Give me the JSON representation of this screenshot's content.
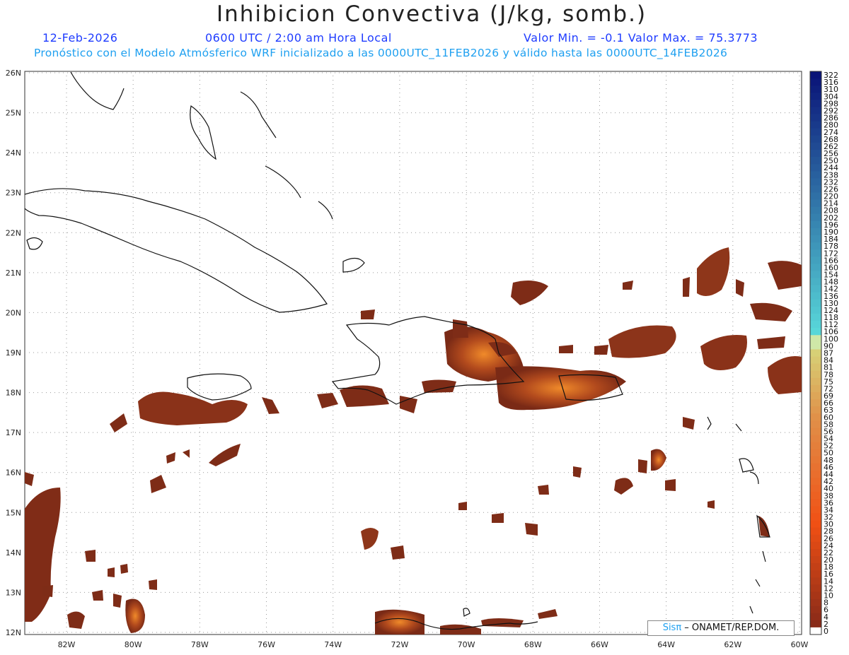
{
  "header": {
    "title": "Inhibicion Convectiva (J/kg, somb.)",
    "date": "12-Feb-2026",
    "time": "0600 UTC / 2:00 am Hora Local",
    "stats": "Valor Min. = -0.1  Valor Max. = 75.3773",
    "subtitle": "Pronóstico con el Modelo Atmósferico WRF inicializado a las 0000UTC_11FEB2026 y válido hasta las  0000UTC_14FEB2026"
  },
  "axes": {
    "lat_labels": [
      "26N",
      "25N",
      "24N",
      "23N",
      "22N",
      "21N",
      "20N",
      "19N",
      "18N",
      "17N",
      "16N",
      "15N",
      "14N",
      "13N",
      "12N"
    ],
    "lon_labels": [
      "82W",
      "80W",
      "78W",
      "76W",
      "74W",
      "72W",
      "70W",
      "68W",
      "66W",
      "64W",
      "62W",
      "60W"
    ]
  },
  "colorbar": {
    "labels": [
      "322",
      "316",
      "310",
      "304",
      "298",
      "292",
      "286",
      "280",
      "274",
      "268",
      "262",
      "256",
      "250",
      "244",
      "238",
      "232",
      "226",
      "220",
      "214",
      "208",
      "202",
      "196",
      "190",
      "184",
      "178",
      "172",
      "166",
      "160",
      "154",
      "148",
      "142",
      "136",
      "130",
      "124",
      "118",
      "112",
      "106",
      "100",
      "90",
      "87",
      "84",
      "81",
      "78",
      "75",
      "72",
      "69",
      "66",
      "63",
      "60",
      "58",
      "56",
      "54",
      "52",
      "50",
      "48",
      "46",
      "44",
      "42",
      "40",
      "38",
      "36",
      "34",
      "32",
      "30",
      "28",
      "26",
      "24",
      "22",
      "20",
      "18",
      "16",
      "14",
      "12",
      "10",
      "8",
      "6",
      "4",
      "2",
      "0"
    ]
  },
  "colors": {
    "field_dark": "#7a2a16",
    "field_mid": "#a0401c",
    "field_hot": "#e07a20"
  },
  "credit": {
    "logo": "Sisπ",
    "text": " – ONAMET/REP.DOM."
  }
}
